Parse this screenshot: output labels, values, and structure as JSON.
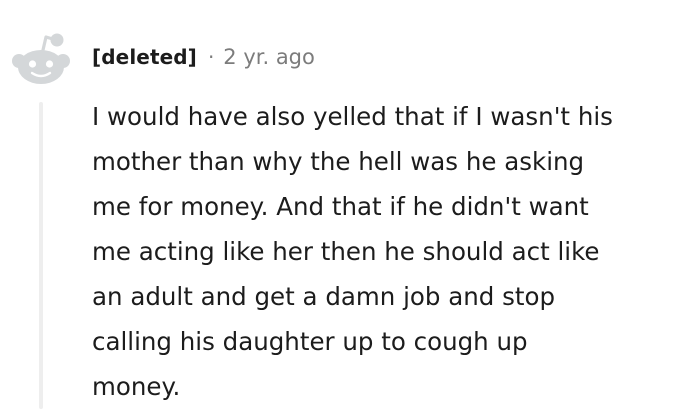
{
  "comment": {
    "author": "[deleted]",
    "separator": "·",
    "timestamp": "2 yr. ago",
    "avatar_icon": "deleted-user-avatar-icon",
    "body_lines": [
      "I would have also yelled that if I wasn't his",
      "mother than why the hell was he asking",
      "me for money. And that if he didn't want",
      "me acting like her then he should act like",
      "an adult and get a damn job and stop",
      "calling his daughter up to cough up",
      "money."
    ]
  },
  "colors": {
    "avatar_gray": "#d4d7d9",
    "meta_gray": "#7c7c7c",
    "thread_line": "#eeeeee",
    "text": "#1c1c1c"
  }
}
